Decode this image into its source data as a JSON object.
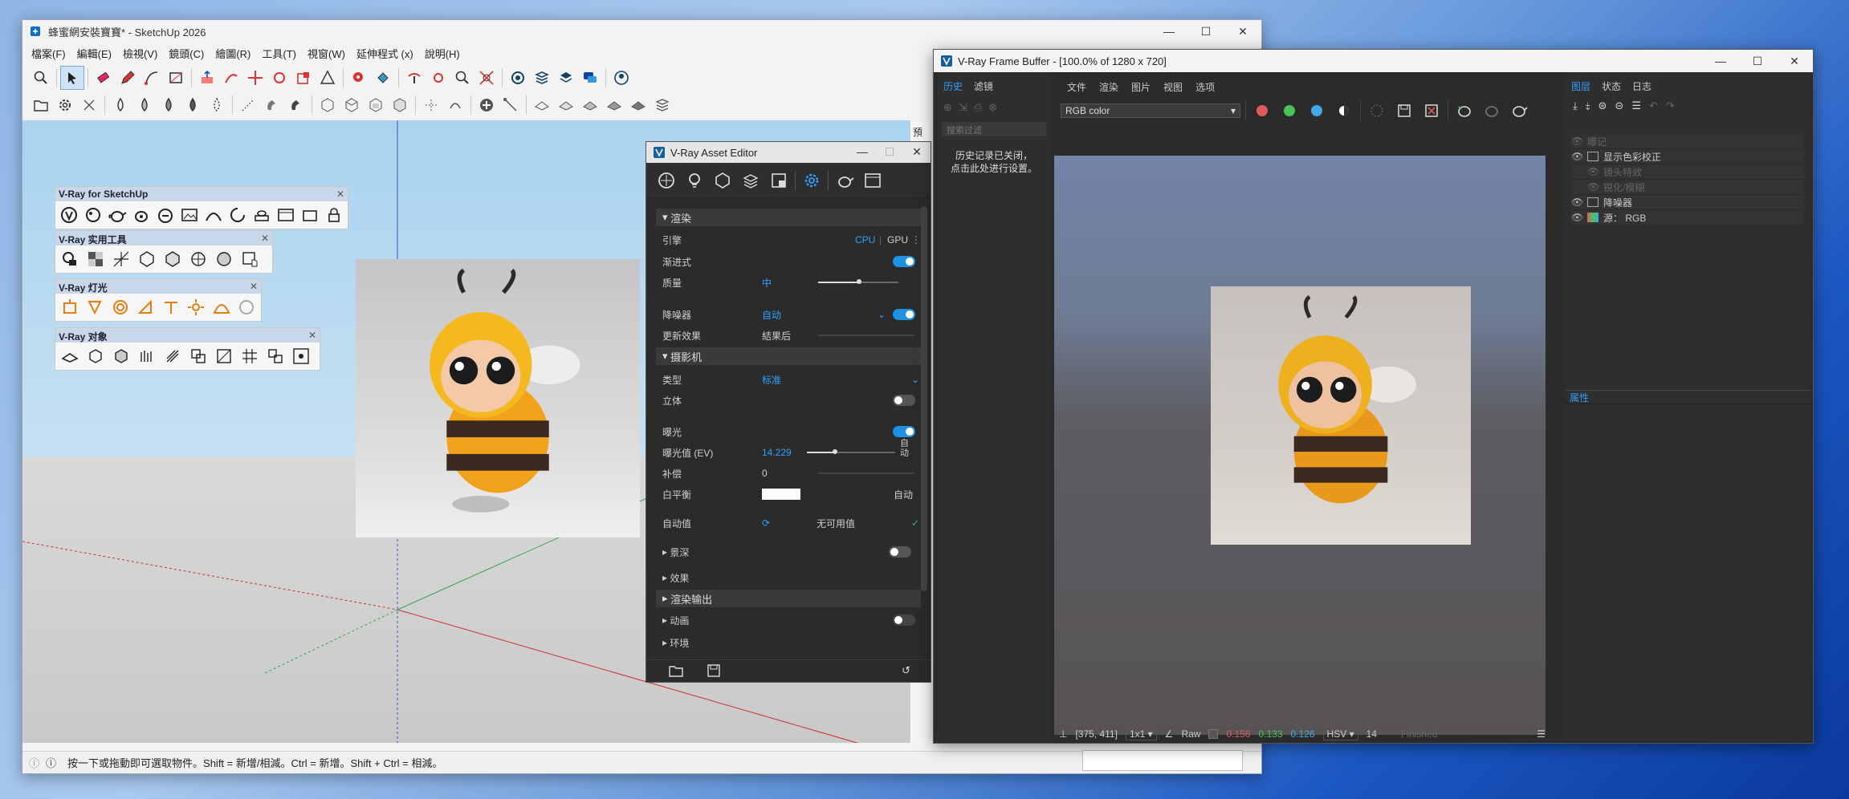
{
  "sketchup": {
    "title": "蜂蜜網安裝寶寶* - SketchUp 2026",
    "menu": [
      "檔案(F)",
      "編輯(E)",
      "檢視(V)",
      "鏡頭(C)",
      "繪圖(R)",
      "工具(T)",
      "視窗(W)",
      "延伸程式 (x)",
      "說明(H)"
    ],
    "status_text": "按一下或拖動即可選取物件。Shift = 新增/相減。Ctrl = 新增。Shift + Ctrl = 相減。",
    "right_strip_label": "預設"
  },
  "vray_toolbars": {
    "main": "V-Ray for SketchUp",
    "utilities": "V-Ray 实用工具",
    "lights": "V-Ray 灯光",
    "objects": "V-Ray 对象"
  },
  "asset_editor": {
    "title": "V-Ray Asset Editor",
    "sections": {
      "render": "渲染",
      "camera": "摄影机",
      "dof": "景深",
      "effects": "效果",
      "render_output": "渲染输出",
      "animation": "动画",
      "environment": "环境"
    },
    "rows": {
      "engine": "引擎",
      "cpu": "CPU",
      "gpu": "GPU",
      "progressive": "渐进式",
      "quality": "质量",
      "quality_val": "中",
      "denoiser": "降噪器",
      "denoiser_val": "自动",
      "update_effects": "更新效果",
      "update_val": "結果后",
      "type": "类型",
      "type_val": "标准",
      "stereo": "立体",
      "exposure": "曝光",
      "ev": "曝光值 (EV)",
      "ev_val": "14.229",
      "auto_lbl": "自动",
      "comp": "补偿",
      "comp_val": "0",
      "wb": "白平衡",
      "wb_val": "自动",
      "auto_value": "自动值",
      "no_value": "无可用值"
    }
  },
  "vfb": {
    "title": "V-Ray Frame Buffer - [100.0% of 1280 x 720]",
    "left_tabs": [
      "历史",
      "滤镜"
    ],
    "search_placeholder": "搜索过滤",
    "history_msg_1": "历史记录已关闭，",
    "history_msg_2": "点击此处进行设置。",
    "menu": [
      "文件",
      "渲染",
      "图片",
      "视图",
      "选项"
    ],
    "channel": "RGB color",
    "right_tabs": [
      "图层",
      "状态",
      "日志"
    ],
    "layers": [
      "曝记",
      "显示色彩校正",
      "镜头特效",
      "锐化/模糊",
      "降噪器",
      "源： RGB"
    ],
    "properties_label": "属性",
    "status": {
      "coords": "[375, 411]",
      "zoom": "1x1",
      "raw": "Raw",
      "r": "0.156",
      "g": "0.133",
      "b": "0.126",
      "mode": "HSV",
      "num": "14",
      "state": "Finished"
    }
  }
}
